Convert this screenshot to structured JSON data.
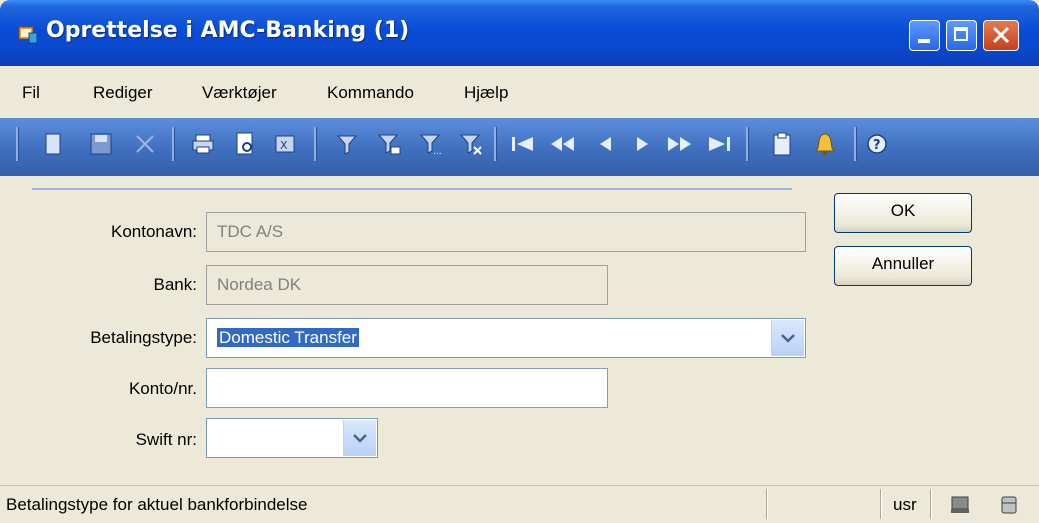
{
  "window": {
    "title": "Oprettelse i AMC-Banking (1)"
  },
  "menu": [
    "Fil",
    "Rediger",
    "Værktøjer",
    "Kommando",
    "Hjælp"
  ],
  "toolbar": {
    "icons": [
      "new-icon",
      "save-icon",
      "delete-icon",
      "print-icon",
      "print-preview-icon",
      "export-icon",
      "filter-icon",
      "filter-field-icon",
      "filter-advanced-icon",
      "clear-filter-icon",
      "first-record-icon",
      "previous-page-icon",
      "previous-record-icon",
      "next-record-icon",
      "next-page-icon",
      "last-record-icon",
      "paste-icon",
      "alert-icon",
      "help-icon"
    ]
  },
  "form": {
    "kontonavn": {
      "label": "Kontonavn:",
      "value": "TDC A/S"
    },
    "bank": {
      "label": "Bank:",
      "value": "Nordea DK"
    },
    "betalingstype": {
      "label": "Betalingstype:",
      "value": "Domestic Transfer"
    },
    "konto": {
      "label": "Konto/nr.",
      "value": ""
    },
    "swift": {
      "label": "Swift nr:",
      "value": ""
    }
  },
  "buttons": {
    "ok": "OK",
    "annuller": "Annuller"
  },
  "status": {
    "text": "Betalingstype for aktuel bankforbindelse",
    "user": "usr"
  },
  "colors": {
    "title_bar": "#0a4cd6",
    "toolbar": "#3f6fbe",
    "selection": "#316ac5"
  }
}
